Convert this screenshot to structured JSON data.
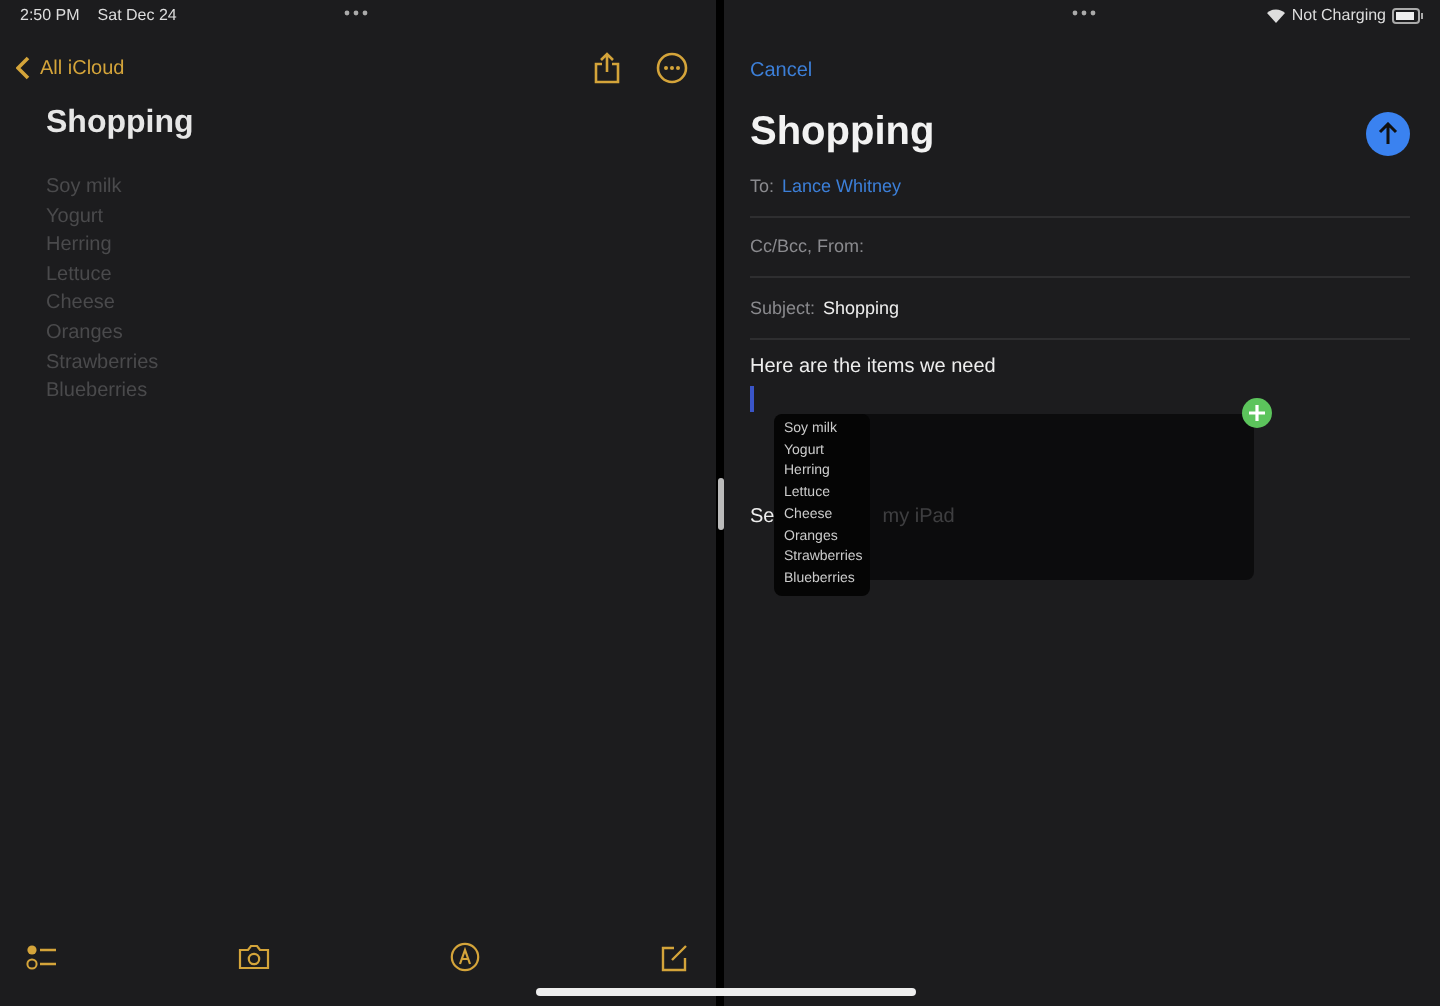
{
  "status_bar": {
    "time": "2:50 PM",
    "date": "Sat Dec 24",
    "battery_label": "Not Charging"
  },
  "note": {
    "back_label": "All iCloud",
    "title": "Shopping",
    "items": [
      "Soy milk",
      "Yogurt",
      "Herring",
      "Lettuce",
      "Cheese",
      "Oranges",
      "Strawberries",
      "Blueberries"
    ]
  },
  "mail": {
    "cancel": "Cancel",
    "title": "Shopping",
    "fields": [
      {
        "label": "To:",
        "value": "Lance Whitney",
        "kind": "recipient"
      },
      {
        "label": "Cc/Bcc, From:",
        "kind": "plain"
      },
      {
        "label": "Subject:",
        "value": "Shopping",
        "kind": "text"
      }
    ],
    "body": "Here are the items we need",
    "signature_parts": [
      "Se",
      "my iPad"
    ],
    "drag_items": [
      "Soy milk",
      "Yogurt",
      "Herring",
      "Lettuce",
      "Cheese",
      "Oranges",
      "Strawberries",
      "Blueberries"
    ]
  }
}
